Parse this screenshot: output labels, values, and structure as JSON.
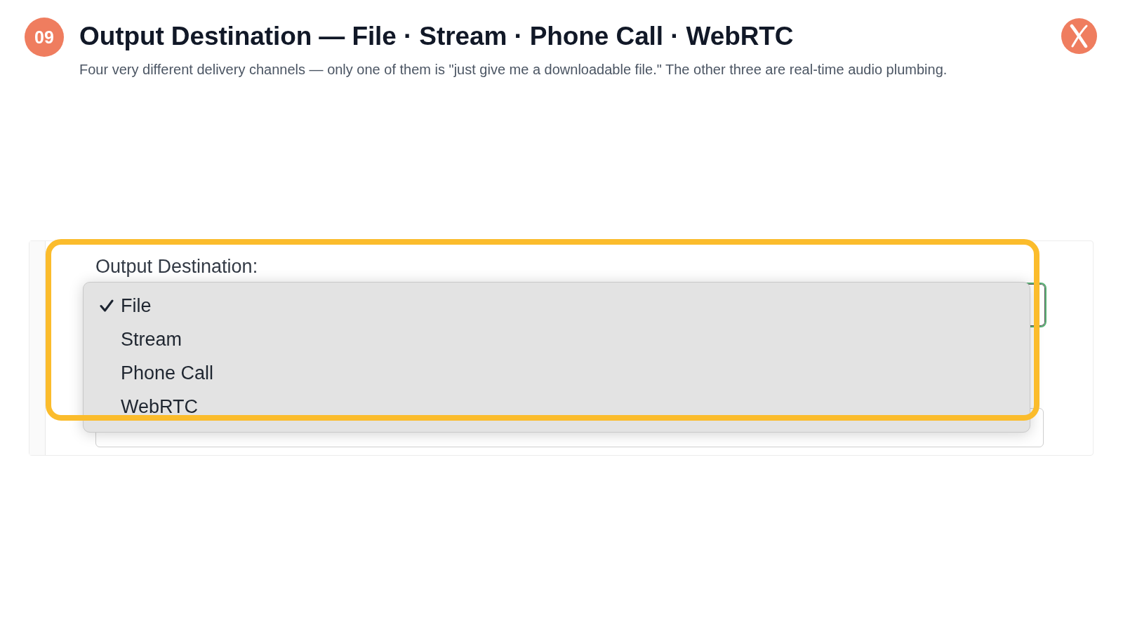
{
  "header": {
    "badge": "09",
    "title": "Output Destination — File · Stream · Phone Call · WebRTC",
    "subtitle": "Four very different delivery channels — only one of them is \"just give me a downloadable file.\" The other three are real-time audio plumbing."
  },
  "form": {
    "label": "Output Destination:",
    "dropdown": {
      "options": [
        {
          "label": "File",
          "selected": true
        },
        {
          "label": "Stream",
          "selected": false
        },
        {
          "label": "Phone Call",
          "selected": false
        },
        {
          "label": "WebRTC",
          "selected": false
        }
      ]
    }
  }
}
